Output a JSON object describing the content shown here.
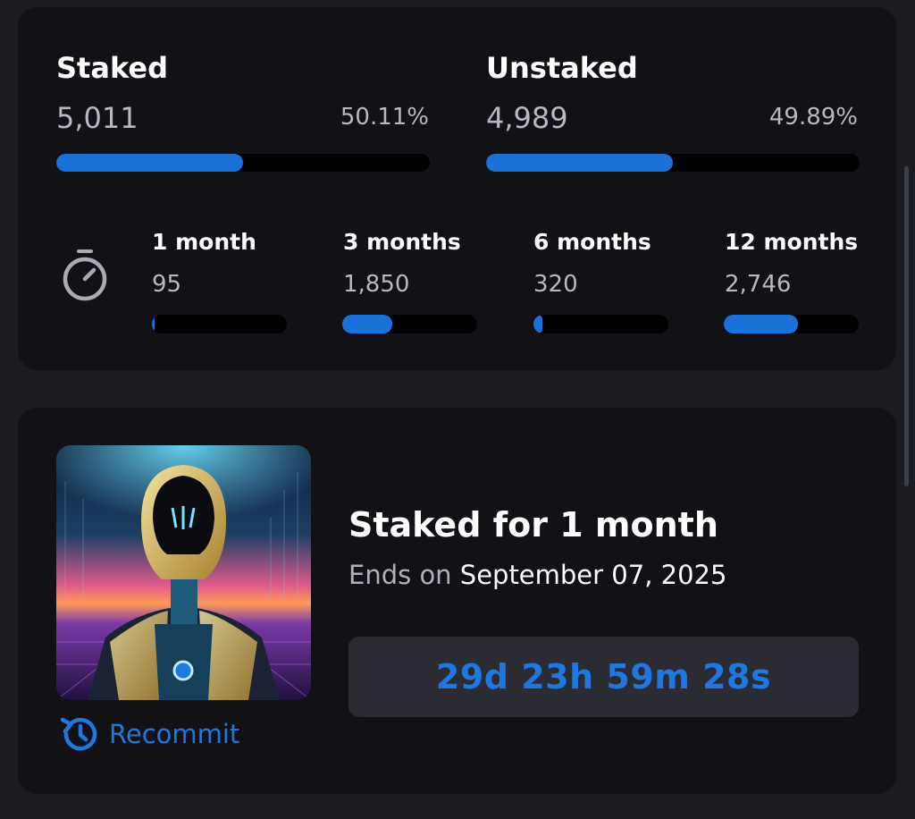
{
  "summary": {
    "staked": {
      "title": "Staked",
      "count": "5,011",
      "percent": "50.11%",
      "fill": 0.5011
    },
    "unstaked": {
      "title": "Unstaked",
      "count": "4,989",
      "percent": "49.89%",
      "fill": 0.4989
    }
  },
  "periods": [
    {
      "label": "1 month",
      "count": "95",
      "fill": 0.018
    },
    {
      "label": "3 months",
      "count": "1,850",
      "fill": 0.37
    },
    {
      "label": "6 months",
      "count": "320",
      "fill": 0.064
    },
    {
      "label": "12 months",
      "count": "2,746",
      "fill": 0.55
    }
  ],
  "nft": {
    "staked_for": "Staked for 1 month",
    "ends_label": "Ends on",
    "ends_date": "September 07, 2025",
    "countdown": "29d 23h 59m 28s",
    "recommit_label": "Recommit"
  },
  "colors": {
    "accent": "#1a72d9",
    "card": "#111116",
    "background": "#1b1c22"
  },
  "icons": {
    "timer": "stopwatch-icon",
    "recommit": "history-refresh-icon"
  }
}
